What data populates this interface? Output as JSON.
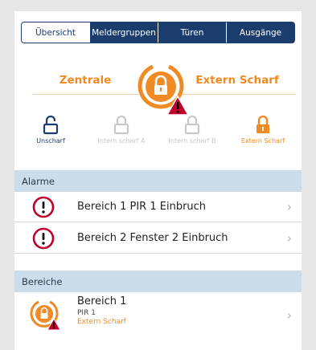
{
  "tabs": [
    {
      "label": "Übersicht",
      "active": true
    },
    {
      "label": "Meldergruppen",
      "active": false
    },
    {
      "label": "Türen",
      "active": false
    },
    {
      "label": "Ausgänge",
      "active": false
    }
  ],
  "status": {
    "left_label": "Zentrale",
    "right_label": "Extern Scharf",
    "icon": "lock-warning-icon"
  },
  "modes": [
    {
      "label": "Unscharf",
      "color": "#1b3d6d",
      "icon": "lock-open-icon"
    },
    {
      "label": "Intern scharf A",
      "color": "#c8c8c8",
      "icon": "lock-closed-icon"
    },
    {
      "label": "Intern scharf B",
      "color": "#c8c8c8",
      "icon": "lock-closed-icon"
    },
    {
      "label": "Extern Scharf",
      "color": "#f08a24",
      "icon": "lock-closed-icon"
    }
  ],
  "alarme": {
    "title": "Alarme",
    "items": [
      {
        "text": "Bereich 1 PIR 1 Einbruch",
        "icon": "alarm-exclamation-icon"
      },
      {
        "text": "Bereich 2 Fenster 2 Einbruch",
        "icon": "alarm-exclamation-icon"
      }
    ]
  },
  "bereiche": {
    "title": "Bereiche",
    "items": [
      {
        "name": "Bereich 1",
        "sub": "PIR 1",
        "state": "Extern Scharf",
        "icon": "lock-warning-icon"
      }
    ]
  },
  "colors": {
    "navy": "#1b3d6d",
    "orange": "#f08a24",
    "alarm_red": "#c0002a",
    "section_bg": "#cbdceb"
  }
}
